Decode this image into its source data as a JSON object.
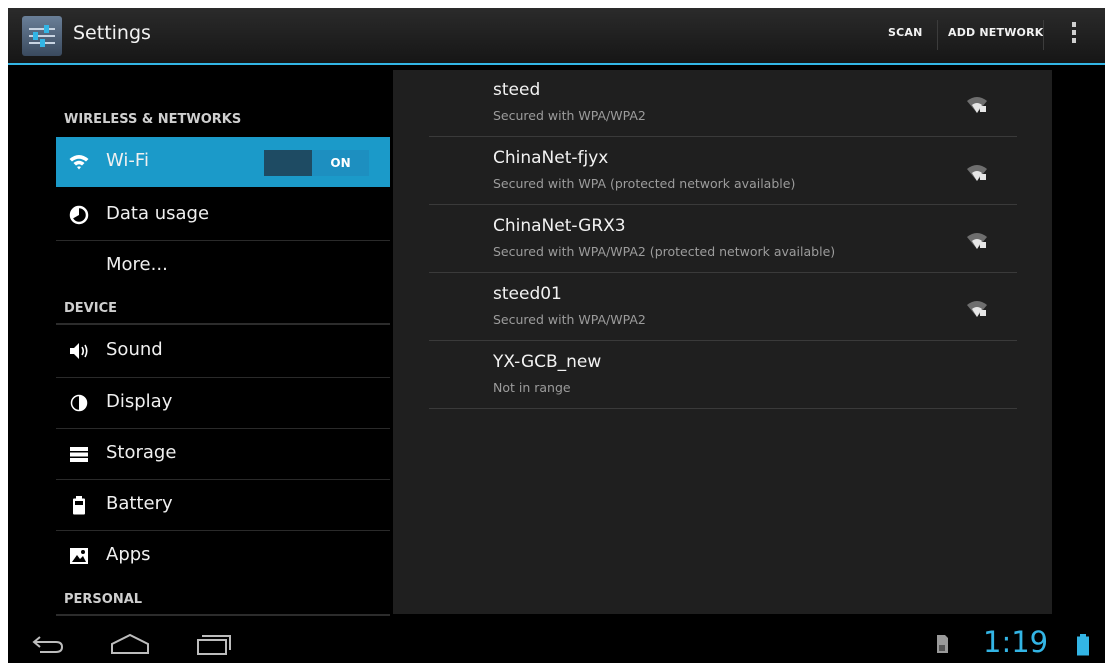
{
  "actionbar": {
    "title": "Settings",
    "scan_label": "SCAN",
    "add_network_label": "ADD NETWORK",
    "app_icon": "settings-sliders-icon",
    "overflow_icon": "overflow-menu-icon"
  },
  "sidebar": {
    "sections": [
      {
        "header": "WIRELESS & NETWORKS",
        "items": [
          {
            "label": "Wi-Fi",
            "icon": "wifi-icon",
            "selected": true,
            "toggle": "ON"
          },
          {
            "label": "Data usage",
            "icon": "data-usage-icon"
          },
          {
            "label": "More...",
            "icon": ""
          }
        ]
      },
      {
        "header": "DEVICE",
        "items": [
          {
            "label": "Sound",
            "icon": "sound-icon"
          },
          {
            "label": "Display",
            "icon": "display-icon"
          },
          {
            "label": "Storage",
            "icon": "storage-icon"
          },
          {
            "label": "Battery",
            "icon": "battery-icon"
          },
          {
            "label": "Apps",
            "icon": "apps-icon"
          }
        ]
      },
      {
        "header": "PERSONAL",
        "items": []
      }
    ]
  },
  "networks": [
    {
      "ssid": "steed",
      "status": "Secured with WPA/WPA2",
      "signal_icon": "wifi-lock-icon"
    },
    {
      "ssid": "ChinaNet-fjyx",
      "status": "Secured with WPA (protected network available)",
      "signal_icon": "wifi-lock-icon"
    },
    {
      "ssid": "ChinaNet-GRX3",
      "status": "Secured with WPA/WPA2 (protected network available)",
      "signal_icon": "wifi-lock-icon"
    },
    {
      "ssid": "steed01",
      "status": "Secured with WPA/WPA2",
      "signal_icon": "wifi-lock-icon"
    },
    {
      "ssid": "YX-GCB_new",
      "status": "Not in range",
      "signal_icon": ""
    }
  ],
  "navbar": {
    "back_icon": "back-icon",
    "home_icon": "home-icon",
    "recents_icon": "recents-icon",
    "sd_icon": "sd-card-icon",
    "clock": "1:19",
    "battery_icon": "battery-status-icon"
  },
  "colors": {
    "accent": "#33b5e5",
    "selected_bg": "#1b9ac9",
    "pane_bg": "#1f1f1f"
  }
}
